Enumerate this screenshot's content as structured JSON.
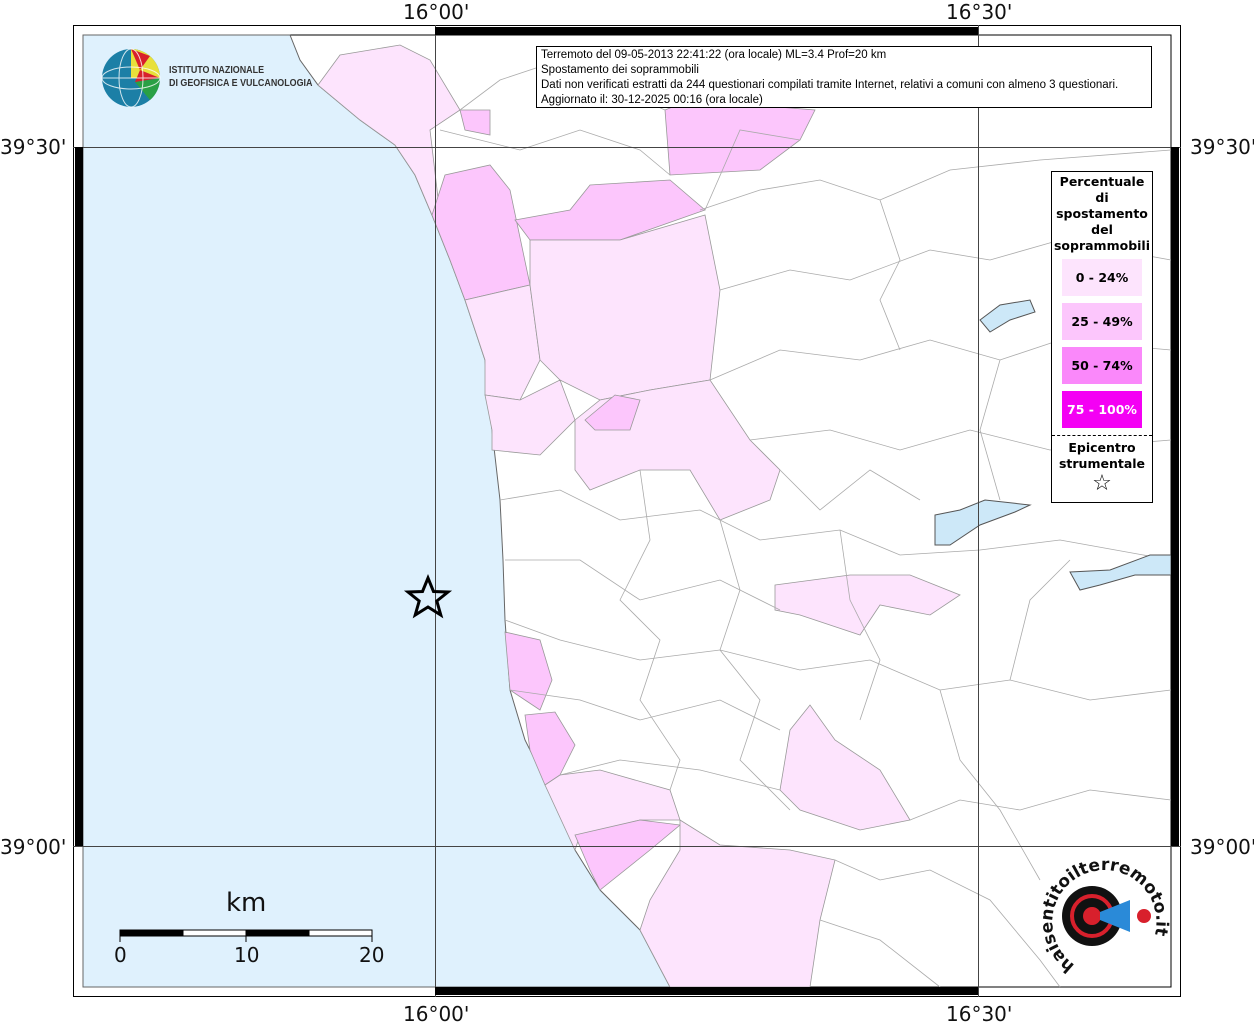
{
  "info_box": {
    "line1": "Terremoto del 09-05-2013 22:41:22 (ora locale) ML=3.4 Prof=20 km",
    "line2": "Spostamento dei soprammobili",
    "line3": "Dati non verificati estratti da 244 questionari compilati tramite Internet, relativi a comuni con almeno 3 questionari.",
    "line4": "Aggiornato il: 30-12-2025 00:16 (ora locale)"
  },
  "coordinates": {
    "lon_left": "16°00'",
    "lon_right": "16°30'",
    "lat_top": "39°30'",
    "lat_bottom": "39°00'"
  },
  "legend": {
    "title_lines": [
      "Percentuale",
      "di",
      "spostamento",
      "del",
      "soprammobili"
    ],
    "classes": [
      {
        "label": "0 - 24%",
        "color": "#fde4fd"
      },
      {
        "label": "25 - 49%",
        "color": "#fcc6fc"
      },
      {
        "label": "50 - 74%",
        "color": "#fa88fa"
      },
      {
        "label": "75 - 100%",
        "color": "#f400f4"
      }
    ],
    "epicenter_lines": [
      "Epicentro",
      "strumentale"
    ],
    "epicenter_symbol": "☆"
  },
  "logo_ingv": {
    "line1": "ISTITUTO NAZIONALE",
    "line2": "DI GEOFISICA E VULCANOLOGIA"
  },
  "logo_hsit": "www.haisentitoilterremoto.it",
  "scale_bar": {
    "unit": "km",
    "ticks": [
      "0",
      "10",
      "20"
    ]
  },
  "colors": {
    "sea": "#dff1fd",
    "border": "#9a9a9a",
    "lake": "#cde8f8"
  }
}
